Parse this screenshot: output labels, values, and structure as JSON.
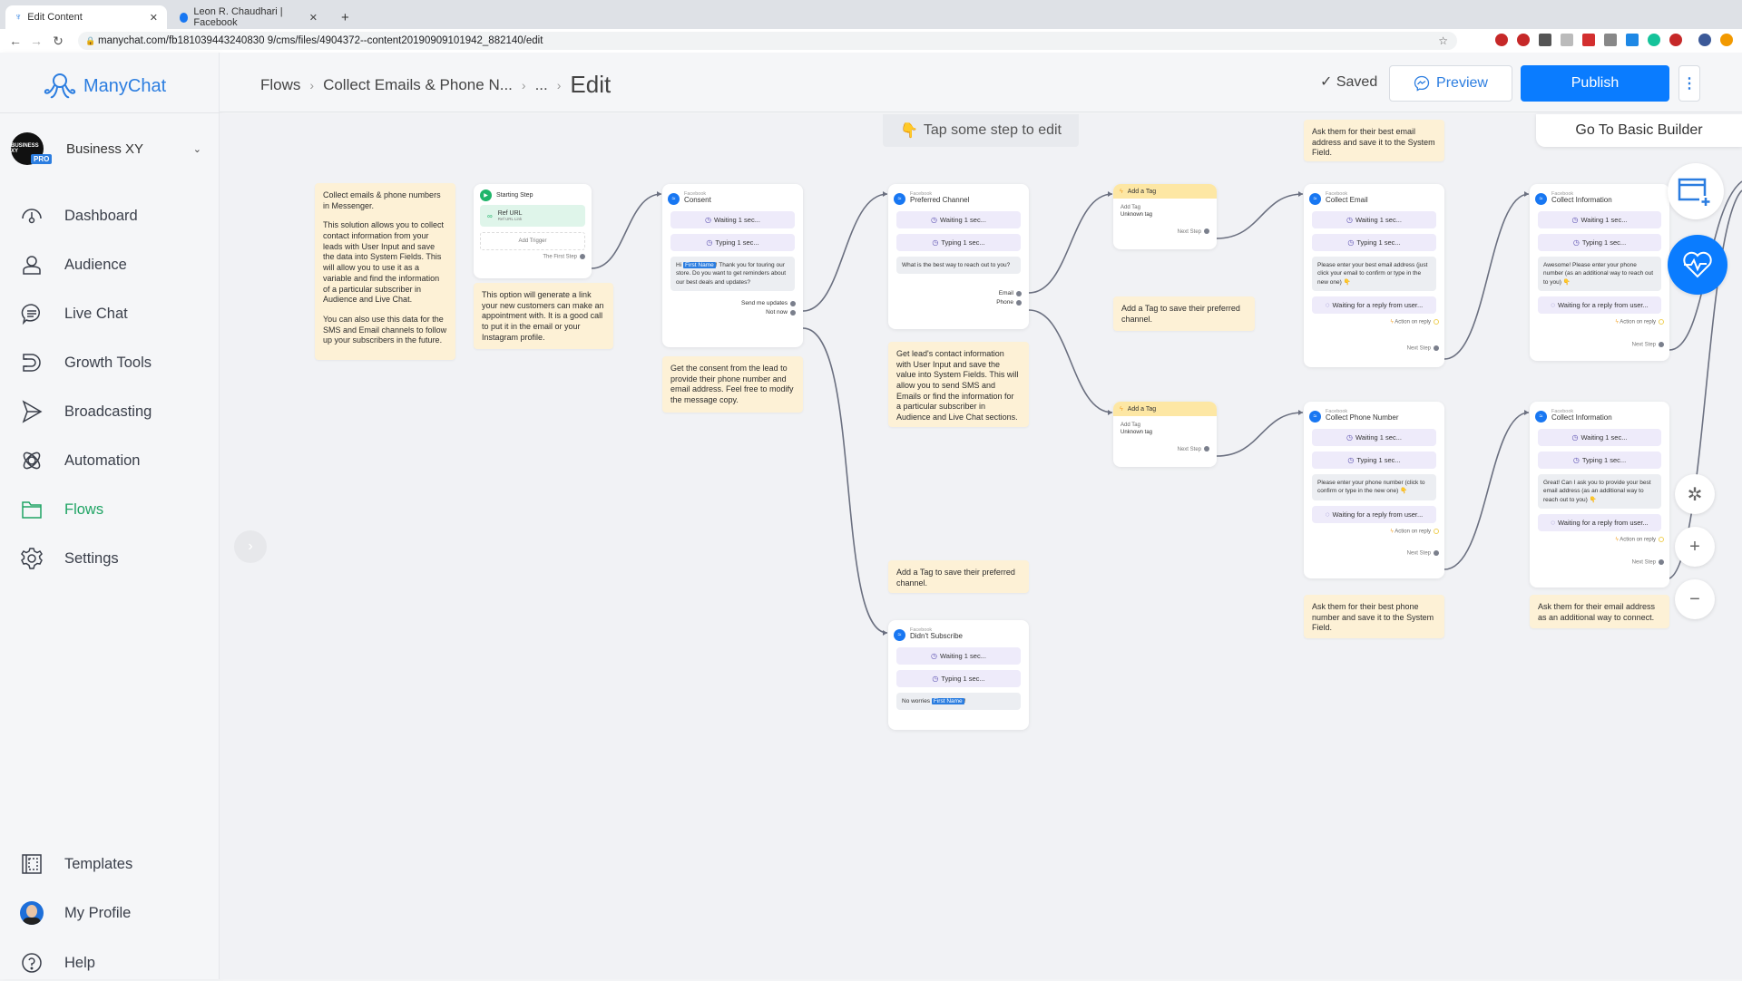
{
  "browser": {
    "tabs": [
      {
        "title": "Edit Content",
        "active": true
      },
      {
        "title": "Leon R. Chaudhari | Facebook",
        "active": false
      }
    ],
    "new_tab_label": "+",
    "url": "manychat.com/fb181039443240830 9/cms/files/4904372--content20190909101942_882140/edit"
  },
  "sidebar": {
    "brand": "ManyChat",
    "account": {
      "name": "Business XY",
      "avatar_text": "BUSINESS XY",
      "badge": "PRO"
    },
    "items": [
      {
        "label": "Dashboard",
        "icon": "gauge-icon"
      },
      {
        "label": "Audience",
        "icon": "user-icon"
      },
      {
        "label": "Live Chat",
        "icon": "chat-bubble-icon"
      },
      {
        "label": "Growth Tools",
        "icon": "magnet-icon"
      },
      {
        "label": "Broadcasting",
        "icon": "send-icon"
      },
      {
        "label": "Automation",
        "icon": "atom-icon"
      },
      {
        "label": "Flows",
        "icon": "folder-icon",
        "active": true
      },
      {
        "label": "Settings",
        "icon": "gear-icon"
      }
    ],
    "bottom_items": [
      {
        "label": "Templates",
        "icon": "templates-icon"
      },
      {
        "label": "My Profile",
        "icon": "avatar"
      },
      {
        "label": "Help",
        "icon": "help-icon"
      }
    ]
  },
  "header": {
    "breadcrumb": [
      "Flows",
      "Collect Emails & Phone N...",
      "...",
      "Edit"
    ],
    "saved_label": "Saved",
    "preview_label": "Preview",
    "publish_label": "Publish",
    "more_label": "⋮"
  },
  "canvas": {
    "tap_hint": "Tap some step to edit",
    "basic_builder_label": "Go To Basic Builder",
    "notes": {
      "intro": [
        "Collect emails & phone numbers in Messenger.",
        "This solution allows you to collect contact information from your leads with User Input and save the data into System Fields. This will allow you to use it as a variable and find the information of a particular subscriber in Audience and Live Chat.",
        "You can also use this data for the SMS and Email channels to follow up your subscribers in the future."
      ],
      "ref_url": "This option will generate a link your new customers can make an appointment with. It is a good call to put it in the email or your Instagram profile.",
      "consent": "Get the consent from the lead to provide their phone number and email address. Feel free to modify the message copy.",
      "preferred": "Get lead's contact information with User Input and save the value into System Fields. This will allow you to send SMS and Emails or find the information for a particular subscriber in Audience and Live Chat sections.",
      "tag_top": "Add a Tag to save their preferred channel.",
      "tag_bottom": "Add a Tag to save their preferred channel.",
      "email": "Ask them for their best email address and save it to the System Field.",
      "phone": "Ask them for their best phone number and save it to the System Field.",
      "info_email": "Ask them for their email address as an additional way to connect."
    },
    "start_node": {
      "title": "Starting Step",
      "trigger": "Ref URL",
      "trigger_sub": "Ref URL Link",
      "add_trigger": "Add Trigger",
      "next": "The First Step"
    },
    "common": {
      "source": "Facebook",
      "waiting": "Waiting 1 sec...",
      "typing": "Typing 1 sec...",
      "waiting_reply": "Waiting for a reply from user...",
      "action_on_reply": "Action on reply",
      "next_step": "Next Step",
      "first_name_var": "First Name"
    },
    "consent_node": {
      "title": "Consent",
      "msg_pre": "Hi",
      "msg_post": "! Thank you for touring our store. Do you want to get reminders about our best deals and updates?",
      "buttons": [
        "Send me updates",
        "Not now"
      ]
    },
    "preferred_node": {
      "title": "Preferred Channel",
      "msg": "What is the best way to reach out to you?",
      "buttons": [
        "Email",
        "Phone"
      ]
    },
    "tag_nodes": [
      {
        "title": "Add a Tag",
        "label": "Add Tag",
        "value": "Unknown tag"
      },
      {
        "title": "Add a Tag",
        "label": "Add Tag",
        "value": "Unknown tag"
      }
    ],
    "didnt_node": {
      "title": "Didn't Subscribe",
      "msg_pre": "No worries",
      "msg_post": "!"
    },
    "email_node": {
      "title": "Collect Email",
      "msg": "Please enter your best email address (just click your email to confirm or type in the new one) 👇"
    },
    "phone_node": {
      "title": "Collect Phone Number",
      "msg": "Please enter your phone number (click to confirm or type in the new one) 👇"
    },
    "info_node_1": {
      "title": "Collect Information",
      "msg": "Awesome! Please enter your phone number (as an additional way to reach out to you) 👇"
    },
    "info_node_2": {
      "title": "Collect Information",
      "msg": "Great! Can I ask you to provide your best email address (as an additional way to reach out to you) 👇"
    }
  },
  "colors": {
    "brand": "#2b7de0",
    "publish": "#0a7cff",
    "active_nav": "#1fa464",
    "note_bg": "#fdf1d6",
    "tag_head": "#fde7a4"
  }
}
